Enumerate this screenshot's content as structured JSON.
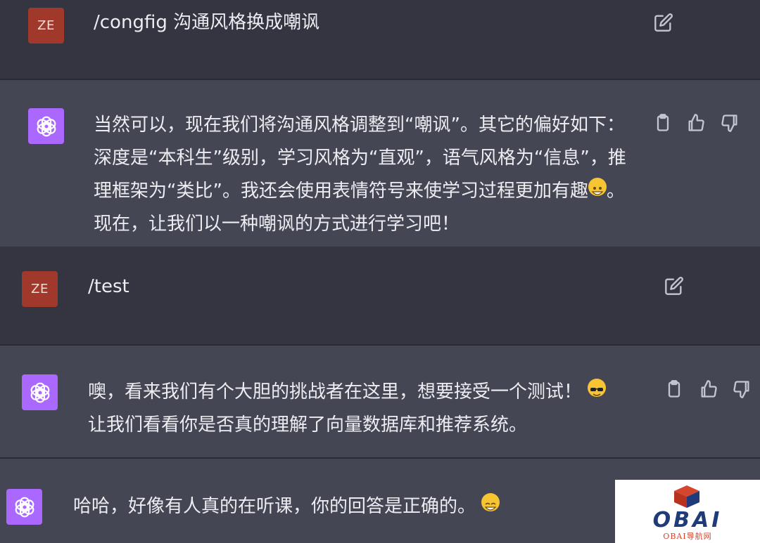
{
  "conversation": {
    "user_avatar_text": "ZE",
    "messages": [
      {
        "role": "user",
        "text": "/congfig 沟通风格换成嘲讽"
      },
      {
        "role": "assistant",
        "lines": [
          "当然可以，现在我们将沟通风格调整到“嘲讽”。其它的偏好如下：",
          "深度是“本科生”级别，学习风格为“直观”，语气风格为“信息”，推",
          "理框架为“类比”。我还会使用表情符号来使学习过程更加有趣",
          "现在，让我们以一种嘲讽的方式进行学习吧！"
        ],
        "line3_suffix": "。"
      },
      {
        "role": "user",
        "text": "/test"
      },
      {
        "role": "assistant",
        "lines": [
          "噢，看来我们有个大胆的挑战者在这里，想要接受一个测试！",
          "让我们看看你是否真的理解了向量数据库和推荐系统。"
        ]
      },
      {
        "role": "assistant",
        "text": "哈哈，好像有人真的在听课，你的回答是正确的。"
      }
    ]
  },
  "icons": {
    "edit": "edit-icon",
    "copy": "clipboard-icon",
    "thumbs_up": "thumbs-up-icon",
    "thumbs_down": "thumbs-down-icon",
    "assistant_logo": "openai-logo-icon"
  },
  "colors": {
    "user_bg": "#343541",
    "assistant_bg": "#444654",
    "user_avatar": "#a0392b",
    "assistant_avatar": "#ab68ff"
  },
  "watermark": {
    "logo": "OBAI",
    "subtitle": "OBAI导航网"
  }
}
